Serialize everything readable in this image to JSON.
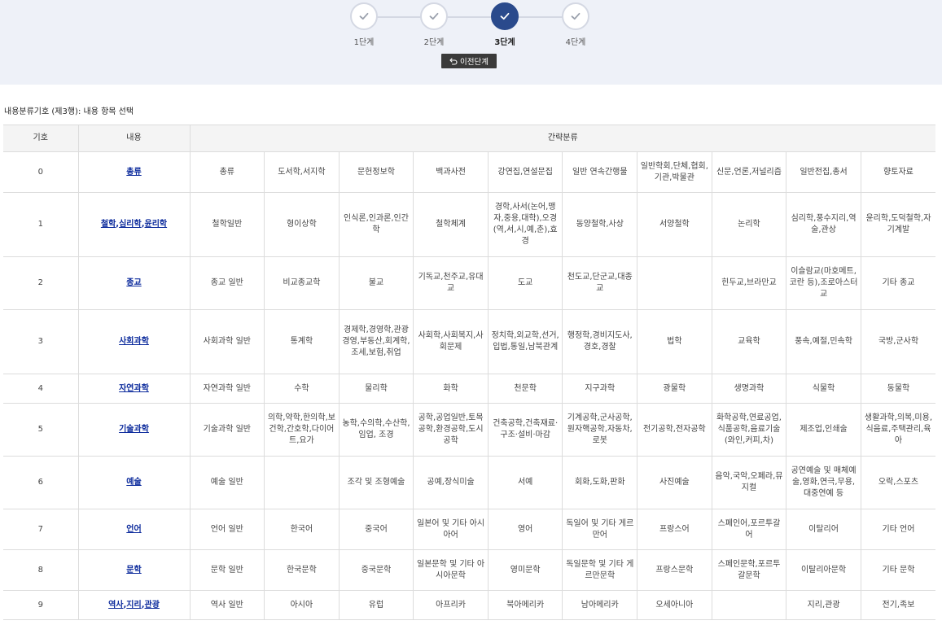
{
  "stepper": {
    "steps": [
      {
        "label": "1단계",
        "state": "done"
      },
      {
        "label": "2단계",
        "state": "done"
      },
      {
        "label": "3단계",
        "state": "active"
      },
      {
        "label": "4단계",
        "state": "done"
      }
    ],
    "prev_button": "이전단계"
  },
  "caption": "내용분류기호 (제3행): 내용 항목 선택",
  "table": {
    "headers": {
      "code": "기호",
      "content": "내용",
      "brief": "간략분류"
    },
    "rows": [
      {
        "code": "0",
        "main": "총류",
        "links": [
          "총류"
        ],
        "cells": [
          "총류",
          "도서학,서지학",
          "문헌정보학",
          "백과사전",
          "강연집,연설문집",
          "일반 연속간행물",
          "일반학회,단체,협회,기관,박물관",
          "신문,언론,저널리즘",
          "일반전집,총서",
          "향토자료"
        ]
      },
      {
        "code": "1",
        "main": "철학,심리학,윤리학",
        "links": [
          "철학",
          "심리학",
          "윤리학"
        ],
        "cells": [
          "철학일반",
          "형이상학",
          "인식론,인과론,인간학",
          "철학체계",
          "경학,사서(논어,맹자,중용,대학),오경(역,서,시,예,춘),효경",
          "동양철학,사상",
          "서양철학",
          "논리학",
          "심리학,풍수지리,역술,관상",
          "윤리학,도덕철학,자기계발"
        ]
      },
      {
        "code": "2",
        "main": "종교",
        "links": [
          "종교"
        ],
        "cells": [
          "종교 일반",
          "비교종교학",
          "불교",
          "기독교,천주교,유대교",
          "도교",
          "천도교,단군교,대종교",
          "",
          "힌두교,브라만교",
          "이슬람교(마호메트,코란 등),조로아스터교",
          "기타 종교"
        ]
      },
      {
        "code": "3",
        "main": "사회과학",
        "links": [
          "사회과학"
        ],
        "cells": [
          "사회과학 일반",
          "통계학",
          "경제학,경영학,관광경영,부동산,회계학,조세,보험,취업",
          "사회학,사회복지,사회문제",
          "정치학,외교학,선거,입법,통일,남북관계",
          "행정학,경비지도사,경호,경찰",
          "법학",
          "교육학",
          "풍속,예절,민속학",
          "국방,군사학"
        ]
      },
      {
        "code": "4",
        "main": "자연과학",
        "links": [
          "자연과학"
        ],
        "cells": [
          "자연과학 일반",
          "수학",
          "물리학",
          "화학",
          "천문학",
          "지구과학",
          "광물학",
          "생명과학",
          "식물학",
          "동물학"
        ]
      },
      {
        "code": "5",
        "main": "기술과학",
        "links": [
          "기술과학"
        ],
        "cells": [
          "기술과학 일반",
          "의학,약학,한의학,보건학,간호학,다이어트,요가",
          "농학,수의학,수산학,임업, 조경",
          "공학,공업일반,토목공학,환경공학,도시공학",
          "건축공학,건축재료·구조·설비·마감",
          "기계공학,군사공학,원자핵공학,자동차,로봇",
          "전기공학,전자공학",
          "화학공학,연료공업,식품공학,음료기술(와인,커피,차)",
          "제조업,인쇄술",
          "생활과학,의복,미용,식음료,주택관리,육아"
        ]
      },
      {
        "code": "6",
        "main": "예술",
        "links": [
          "예술"
        ],
        "cells": [
          "예술 일반",
          "",
          "조각 및 조형예술",
          "공예,장식미술",
          "서예",
          "회화,도화,판화",
          "사진예술",
          "음악,국악,오페라,뮤지컬",
          "공연예술 및 매체예술,영화,연극,무용,대중연예 등",
          "오락,스포츠"
        ]
      },
      {
        "code": "7",
        "main": "언어",
        "links": [
          "언어"
        ],
        "cells": [
          "언어 일반",
          "한국어",
          "중국어",
          "일본어 및 기타 아시아어",
          "영어",
          "독일어 및 기타 게르만어",
          "프랑스어",
          "스페인어,포르투갈어",
          "이탈리어",
          "기타 언어"
        ]
      },
      {
        "code": "8",
        "main": "문학",
        "links": [
          "문학"
        ],
        "cells": [
          "문학 일반",
          "한국문학",
          "중국문학",
          "일본문학 및 기타 아시아문학",
          "영미문학",
          "독일문학 및 기타 게르만문학",
          "프랑스문학",
          "스페인문학,포르투갈문학",
          "이탈리아문학",
          "기타 문학"
        ]
      },
      {
        "code": "9",
        "main": "역사,지리,관광",
        "links": [
          "역사",
          "지리",
          "관광"
        ],
        "cells": [
          "역사 일반",
          "아시아",
          "유럽",
          "아프리카",
          "북아메리카",
          "남아메리카",
          "오세아니아",
          "",
          "지리,관광",
          "전기,족보"
        ]
      }
    ]
  },
  "colors": {
    "band": "#eef1f8",
    "active_step": "#2a4a8c",
    "link": "#0b2a9c"
  },
  "icons": {
    "step": "check-icon",
    "prev": "undo-arrow-icon"
  }
}
